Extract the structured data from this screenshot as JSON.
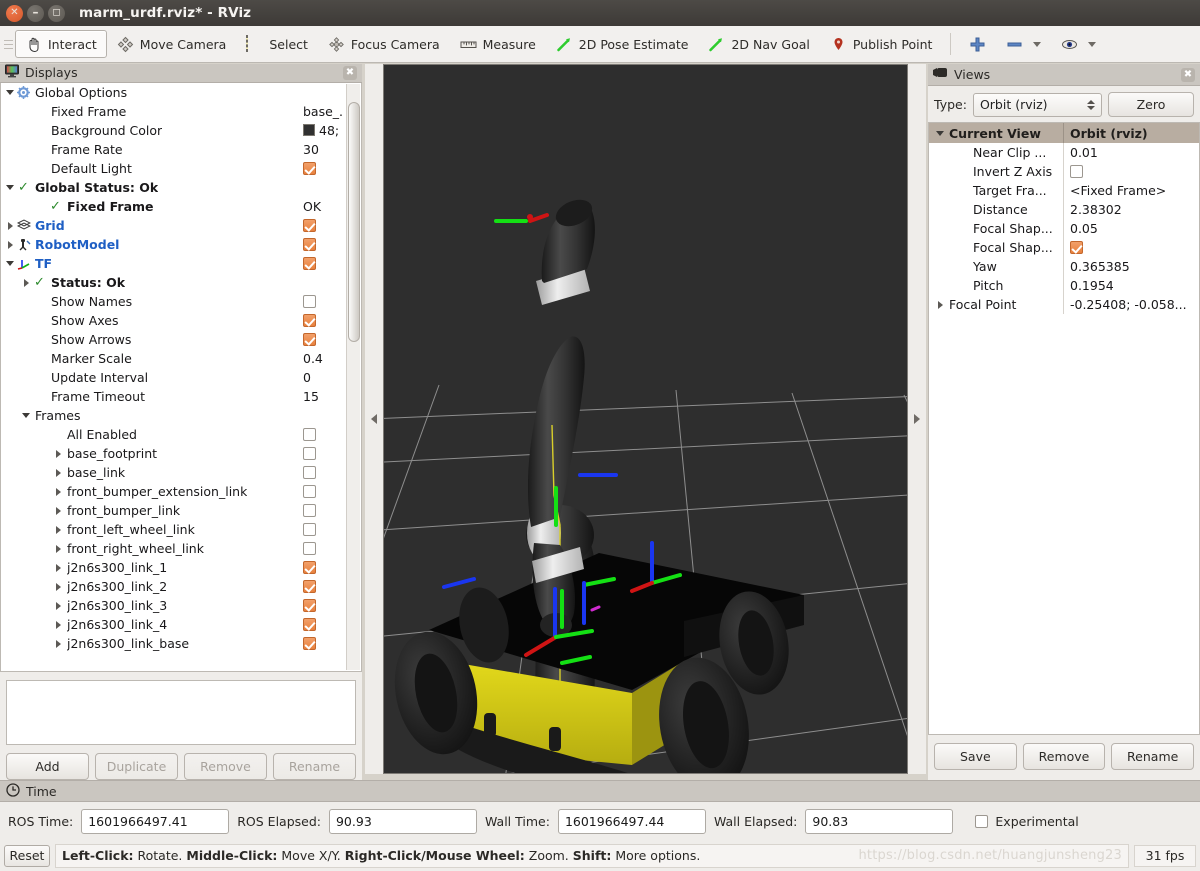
{
  "window": {
    "title": "marm_urdf.rviz* - RViz",
    "buttons": {
      "close": "×",
      "minimize": "–",
      "maximize": "□"
    }
  },
  "toolbar": {
    "items": [
      {
        "label": "Interact",
        "icon": "hand-icon",
        "active": true
      },
      {
        "label": "Move Camera",
        "icon": "move-camera-icon",
        "active": false
      },
      {
        "label": "Select",
        "icon": "select-icon",
        "active": false
      },
      {
        "label": "Focus Camera",
        "icon": "focus-camera-icon",
        "active": false
      },
      {
        "label": "Measure",
        "icon": "ruler-icon",
        "active": false
      },
      {
        "label": "2D Pose Estimate",
        "icon": "pose-arrow-icon",
        "active": false
      },
      {
        "label": "2D Nav Goal",
        "icon": "nav-goal-arrow-icon",
        "active": false
      },
      {
        "label": "Publish Point",
        "icon": "map-pin-icon",
        "active": false
      }
    ],
    "add_icon": "plus-icon",
    "remove_icon": "minus-icon",
    "visibility_icon": "eye-icon"
  },
  "displays": {
    "title": "Displays",
    "title_icon": "monitor-icon",
    "close_icon": "close-icon",
    "rows": [
      {
        "indent": 0,
        "twisty": "down",
        "icon": "gear-icon",
        "label": "Global Options",
        "style": "plain",
        "value": "",
        "valueType": "none"
      },
      {
        "indent": 2,
        "twisty": "none",
        "icon": "",
        "label": "Fixed Frame",
        "style": "plain",
        "value": "base_.",
        "valueType": "text"
      },
      {
        "indent": 2,
        "twisty": "none",
        "icon": "",
        "label": "Background Color",
        "style": "plain",
        "value": "48;",
        "valueType": "color"
      },
      {
        "indent": 2,
        "twisty": "none",
        "icon": "",
        "label": "Frame Rate",
        "style": "plain",
        "value": "30",
        "valueType": "text"
      },
      {
        "indent": 2,
        "twisty": "none",
        "icon": "",
        "label": "Default Light",
        "style": "plain",
        "value": "",
        "valueType": "checked"
      },
      {
        "indent": 0,
        "twisty": "down",
        "icon": "check-icon",
        "label": "Global Status: Ok",
        "style": "bold",
        "value": "",
        "valueType": "none"
      },
      {
        "indent": 2,
        "twisty": "none",
        "icon": "check-icon",
        "label": "Fixed Frame",
        "style": "bold",
        "value": "OK",
        "valueType": "text"
      },
      {
        "indent": 0,
        "twisty": "right",
        "icon": "grid-icon",
        "label": "Grid",
        "style": "blue",
        "value": "",
        "valueType": "checked"
      },
      {
        "indent": 0,
        "twisty": "right",
        "icon": "robot-icon",
        "label": "RobotModel",
        "style": "blue",
        "value": "",
        "valueType": "checked"
      },
      {
        "indent": 0,
        "twisty": "down",
        "icon": "tf-axes-icon",
        "label": "TF",
        "style": "blue",
        "value": "",
        "valueType": "checked"
      },
      {
        "indent": 1,
        "twisty": "right",
        "icon": "check-icon",
        "label": "Status: Ok",
        "style": "bold",
        "value": "",
        "valueType": "none"
      },
      {
        "indent": 2,
        "twisty": "none",
        "icon": "",
        "label": "Show Names",
        "style": "plain",
        "value": "",
        "valueType": "unchecked"
      },
      {
        "indent": 2,
        "twisty": "none",
        "icon": "",
        "label": "Show Axes",
        "style": "plain",
        "value": "",
        "valueType": "checked"
      },
      {
        "indent": 2,
        "twisty": "none",
        "icon": "",
        "label": "Show Arrows",
        "style": "plain",
        "value": "",
        "valueType": "checked"
      },
      {
        "indent": 2,
        "twisty": "none",
        "icon": "",
        "label": "Marker Scale",
        "style": "plain",
        "value": "0.4",
        "valueType": "text"
      },
      {
        "indent": 2,
        "twisty": "none",
        "icon": "",
        "label": "Update Interval",
        "style": "plain",
        "value": "0",
        "valueType": "text"
      },
      {
        "indent": 2,
        "twisty": "none",
        "icon": "",
        "label": "Frame Timeout",
        "style": "plain",
        "value": "15",
        "valueType": "text"
      },
      {
        "indent": 1,
        "twisty": "down",
        "icon": "",
        "label": "Frames",
        "style": "plain",
        "value": "",
        "valueType": "none"
      },
      {
        "indent": 3,
        "twisty": "none",
        "icon": "",
        "label": "All Enabled",
        "style": "plain",
        "value": "",
        "valueType": "unchecked"
      },
      {
        "indent": 3,
        "twisty": "right",
        "icon": "",
        "label": "base_footprint",
        "style": "plain",
        "value": "",
        "valueType": "unchecked"
      },
      {
        "indent": 3,
        "twisty": "right",
        "icon": "",
        "label": "base_link",
        "style": "plain",
        "value": "",
        "valueType": "unchecked"
      },
      {
        "indent": 3,
        "twisty": "right",
        "icon": "",
        "label": "front_bumper_extension_link",
        "style": "plain",
        "value": "",
        "valueType": "unchecked"
      },
      {
        "indent": 3,
        "twisty": "right",
        "icon": "",
        "label": "front_bumper_link",
        "style": "plain",
        "value": "",
        "valueType": "unchecked"
      },
      {
        "indent": 3,
        "twisty": "right",
        "icon": "",
        "label": "front_left_wheel_link",
        "style": "plain",
        "value": "",
        "valueType": "unchecked"
      },
      {
        "indent": 3,
        "twisty": "right",
        "icon": "",
        "label": "front_right_wheel_link",
        "style": "plain",
        "value": "",
        "valueType": "unchecked"
      },
      {
        "indent": 3,
        "twisty": "right",
        "icon": "",
        "label": "j2n6s300_link_1",
        "style": "plain",
        "value": "",
        "valueType": "checked"
      },
      {
        "indent": 3,
        "twisty": "right",
        "icon": "",
        "label": "j2n6s300_link_2",
        "style": "plain",
        "value": "",
        "valueType": "checked"
      },
      {
        "indent": 3,
        "twisty": "right",
        "icon": "",
        "label": "j2n6s300_link_3",
        "style": "plain",
        "value": "",
        "valueType": "checked"
      },
      {
        "indent": 3,
        "twisty": "right",
        "icon": "",
        "label": "j2n6s300_link_4",
        "style": "plain",
        "value": "",
        "valueType": "checked"
      },
      {
        "indent": 3,
        "twisty": "right",
        "icon": "",
        "label": "j2n6s300_link_base",
        "style": "plain",
        "value": "",
        "valueType": "checked"
      }
    ],
    "buttons": [
      {
        "label": "Add",
        "enabled": true
      },
      {
        "label": "Duplicate",
        "enabled": false
      },
      {
        "label": "Remove",
        "enabled": false
      },
      {
        "label": "Rename",
        "enabled": false
      }
    ]
  },
  "views": {
    "title": "Views",
    "title_icon": "camera-icon",
    "close_icon": "close-icon",
    "type_label": "Type:",
    "type_value": "Orbit (rviz)",
    "zero_button": "Zero",
    "header": {
      "col1": "Current View",
      "col2": "Orbit (rviz)"
    },
    "rows": [
      {
        "indent": 1,
        "twisty": "none",
        "label": "Near Clip ...",
        "value": "0.01",
        "valueType": "text"
      },
      {
        "indent": 1,
        "twisty": "none",
        "label": "Invert Z Axis",
        "value": "",
        "valueType": "unchecked"
      },
      {
        "indent": 1,
        "twisty": "none",
        "label": "Target Fra...",
        "value": "<Fixed Frame>",
        "valueType": "text"
      },
      {
        "indent": 1,
        "twisty": "none",
        "label": "Distance",
        "value": "2.38302",
        "valueType": "text"
      },
      {
        "indent": 1,
        "twisty": "none",
        "label": "Focal Shap...",
        "value": "0.05",
        "valueType": "text"
      },
      {
        "indent": 1,
        "twisty": "none",
        "label": "Focal Shap...",
        "value": "",
        "valueType": "checked"
      },
      {
        "indent": 1,
        "twisty": "none",
        "label": "Yaw",
        "value": "0.365385",
        "valueType": "text"
      },
      {
        "indent": 1,
        "twisty": "none",
        "label": "Pitch",
        "value": "0.1954",
        "valueType": "text"
      },
      {
        "indent": 0,
        "twisty": "right",
        "label": "Focal Point",
        "value": "-0.25408; -0.058...",
        "valueType": "text"
      }
    ],
    "buttons": [
      {
        "label": "Save",
        "enabled": true
      },
      {
        "label": "Remove",
        "enabled": true
      },
      {
        "label": "Rename",
        "enabled": true
      }
    ]
  },
  "time": {
    "title": "Time",
    "title_icon": "clock-icon",
    "fields": [
      {
        "label": "ROS Time:",
        "value": "1601966497.41"
      },
      {
        "label": "ROS Elapsed:",
        "value": "90.93"
      },
      {
        "label": "Wall Time:",
        "value": "1601966497.44"
      },
      {
        "label": "Wall Elapsed:",
        "value": "90.83"
      }
    ],
    "experimental_label": "Experimental",
    "experimental_checked": false
  },
  "statusbar": {
    "reset_button": "Reset",
    "hint_parts": [
      {
        "text": "Left-Click:",
        "bold": true
      },
      {
        "text": " Rotate. ",
        "bold": false
      },
      {
        "text": "Middle-Click:",
        "bold": true
      },
      {
        "text": " Move X/Y. ",
        "bold": false
      },
      {
        "text": "Right-Click/Mouse Wheel:",
        "bold": true
      },
      {
        "text": " Zoom. ",
        "bold": false
      },
      {
        "text": "Shift:",
        "bold": true
      },
      {
        "text": " More options.",
        "bold": false
      }
    ],
    "watermark": "https://blog.csdn.net/huangjunsheng23",
    "fps": "31 fps"
  },
  "viewport": {
    "background_color": "#2e2e2e",
    "grid_color": "#a8a8a8",
    "robot_body_color": "#0a0a0a",
    "robot_accent_color": "#d6cc17",
    "arm_color": "#2a2a2a",
    "arm_ring_color": "#d8d8d8",
    "axis_x_color": "#ff0000",
    "axis_y_color": "#00ff00",
    "axis_z_color": "#0000ff"
  }
}
